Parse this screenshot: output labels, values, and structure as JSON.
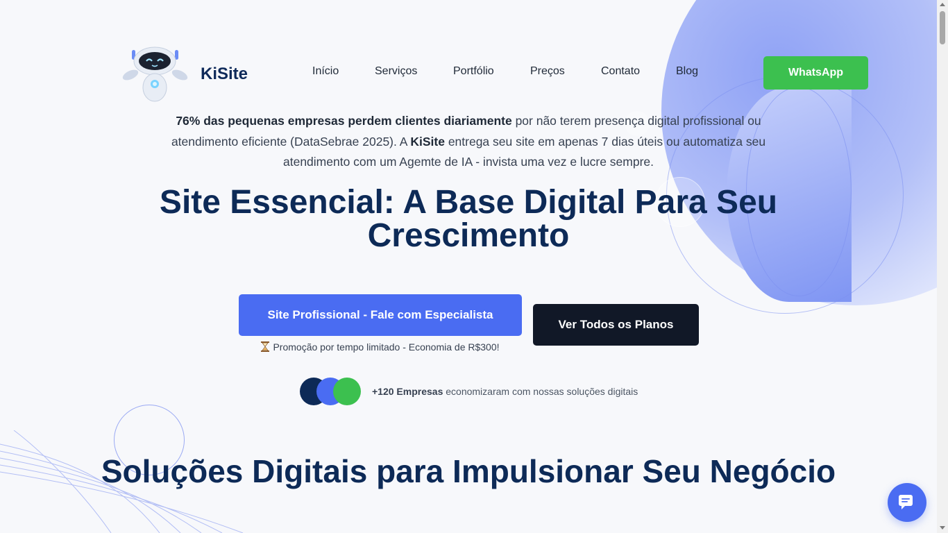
{
  "brand": {
    "name": "KiSite",
    "logo_icon": "robot-mascot-icon"
  },
  "nav": {
    "items": [
      {
        "label": "Início"
      },
      {
        "label": "Serviços"
      },
      {
        "label": "Portfólio"
      },
      {
        "label": "Preços"
      },
      {
        "label": "Contato"
      },
      {
        "label": "Blog"
      }
    ],
    "cta_label": "WhatsApp"
  },
  "hero": {
    "intro_bold": "76% das pequenas empresas perdem clientes diariamente",
    "intro_part1": " por não terem presença digital profissional ou atendimento eficiente (DataSebrae 2025). A ",
    "intro_brand": "KiSite",
    "intro_part2": " entrega seu site em apenas 7 dias úteis ou automatiza seu atendimento com um Agemte de IA - invista uma vez e lucre sempre.",
    "title": "Site Essencial: A Base Digital Para Seu Crescimento",
    "primary_cta": "Site Profissional - Fale com Especialista",
    "secondary_cta": "Ver Todos os Planos",
    "promo_icon": "hourglass-icon",
    "promo_text": "Promoção por tempo limitado - Economia de R$300!",
    "social_count": "+120 Empresas",
    "social_text": " economizaram com nossas soluções digitais"
  },
  "section": {
    "title": "Soluções Digitais para Impulsionar Seu Negócio"
  },
  "chat_widget": {
    "icon": "chat-bubble-icon"
  },
  "colors": {
    "primary": "#4a6cf2",
    "navy": "#0d2a57",
    "whatsapp_green": "#3cc04f",
    "dark_button": "#111827"
  }
}
